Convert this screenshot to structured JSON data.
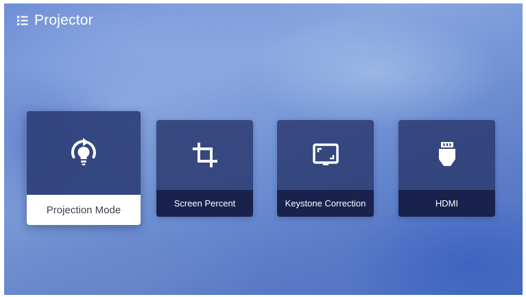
{
  "header": {
    "title": "Projector",
    "icon": "menu-list-icon"
  },
  "cards": [
    {
      "label": "Projection Mode",
      "icon": "projection-mode-icon",
      "focused": true
    },
    {
      "label": "Screen Percent",
      "icon": "crop-icon",
      "focused": false
    },
    {
      "label": "Keystone Correction",
      "icon": "keystone-screen-icon",
      "focused": false
    },
    {
      "label": "HDMI",
      "icon": "hdmi-icon",
      "focused": false
    }
  ],
  "colors": {
    "card_bg": "#2e4078",
    "label_bar_bg": "#162048",
    "focused_label_bg": "#ffffff",
    "focused_label_text": "#3a3f4c",
    "text": "#ffffff"
  }
}
